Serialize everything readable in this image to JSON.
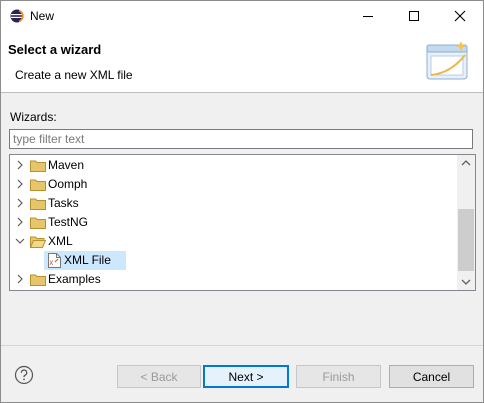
{
  "window": {
    "title": "New"
  },
  "header": {
    "title": "Select a wizard",
    "description": "Create a new XML file"
  },
  "wizards": {
    "label": "Wizards:",
    "filter_placeholder": "type filter text",
    "filter_value": "",
    "tree": [
      {
        "label": "Maven",
        "expanded": false,
        "icon": "folder-icon"
      },
      {
        "label": "Oomph",
        "expanded": false,
        "icon": "folder-icon"
      },
      {
        "label": "Tasks",
        "expanded": false,
        "icon": "folder-icon"
      },
      {
        "label": "TestNG",
        "expanded": false,
        "icon": "folder-icon"
      },
      {
        "label": "XML",
        "expanded": true,
        "icon": "open-folder-icon"
      },
      {
        "label": "XML File",
        "selected": true,
        "icon": "xml-file-icon"
      },
      {
        "label": "Examples",
        "expanded": false,
        "icon": "folder-icon"
      }
    ]
  },
  "buttons": {
    "back": "< Back",
    "next": "Next >",
    "finish": "Finish",
    "cancel": "Cancel"
  },
  "colors": {
    "selection": "#cce8ff",
    "folder": "#dcb35c",
    "default_button_border": "#0078d7"
  }
}
